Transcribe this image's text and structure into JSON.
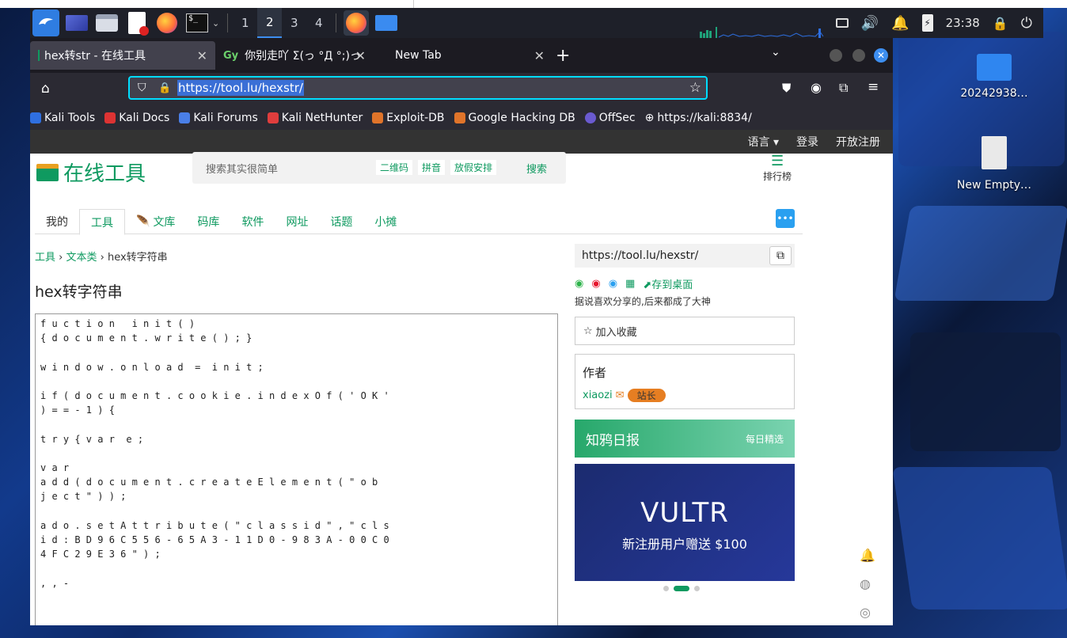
{
  "taskbar": {
    "workspaces": [
      "1",
      "2",
      "3",
      "4"
    ],
    "active_workspace": "2",
    "clock": "23:38",
    "icons": [
      "kali-menu-icon",
      "desktop-icon",
      "file-manager-icon",
      "text-editor-icon",
      "firefox-icon",
      "terminal-icon",
      "dropdown-icon",
      "firefox-window-icon",
      "folder-window-icon"
    ]
  },
  "desktop": {
    "items": [
      {
        "label": "20242938…",
        "icon": "folder-icon"
      },
      {
        "label": "New Empty…",
        "icon": "file-icon"
      }
    ]
  },
  "browser": {
    "tabs": [
      {
        "label": "hex转str - 在线工具",
        "active": true
      },
      {
        "label": "你别走吖 Σ(っ °Д °;)っ",
        "active": false
      },
      {
        "label": "New Tab",
        "active": false
      }
    ],
    "new_tab": "+",
    "url": "https://tool.lu/hexstr/",
    "bookmarks": [
      "Kali Tools",
      "Kali Docs",
      "Kali Forums",
      "Kali NetHunter",
      "Exploit-DB",
      "Google Hacking DB",
      "OffSec",
      "https://kali:8834/"
    ]
  },
  "site": {
    "topnav": [
      "语言",
      "登录",
      "开放注册"
    ],
    "logo_text": "在线工具",
    "search_placeholder": "搜索其实很简单",
    "search_chips": [
      "二维码",
      "拼音",
      "放假安排"
    ],
    "search_button": "搜索",
    "rank_label": "排行榜",
    "menu": [
      "我的",
      "工具",
      "文库",
      "码库",
      "软件",
      "网址",
      "话题",
      "小摊"
    ],
    "active_menu": "工具",
    "breadcrumb": {
      "a": "工具",
      "b": "文本类",
      "c": "hex转字符串"
    },
    "title": "hex转字符串",
    "code_lines": [
      "f u c t i o n   i n i t ( )",
      "{ d o c u m e n t . w r i t e ( ) ; }",
      "",
      "w i n d o w . o n l o a d  =  i n i t ;",
      "",
      "i f ( d o c u m e n t . c o o k i e . i n d e x O f ( ' O K '",
      ") = = - 1 ) {",
      "",
      "t r y { v a r  e ;",
      "",
      "v a r",
      "a d d ( d o c u m e n t . c r e a t e E l e m e n t ( \" o b",
      "j e c t \" ) ) ;",
      "",
      "a d o . s e t A t t r i b u t e ( \" c l a s s i d \" , \" c l s",
      "i d : B D 9 6 C 5 5 6 - 6 5 A 3 - 1 1 D 0 - 9 8 3 A - 0 0 C 0",
      "4 F C 2 9 E 3 6 \" ) ;",
      "",
      ", , -"
    ],
    "side": {
      "share_url": "https://tool.lu/hexstr/",
      "save_desktop": "存到桌面",
      "tip": "据说喜欢分享的,后来都成了大神",
      "favorite": "加入收藏",
      "author_title": "作者",
      "author_name": "xiaozi",
      "author_badge": "站长",
      "daily_title": "知鸦日报",
      "daily_sub": "每日精选",
      "ad_brand": "VULTR",
      "ad_text": "新注册用户赠送 $100"
    }
  },
  "colors": {
    "accent": "#0f9a60",
    "badge": "#e67e22",
    "url_border": "#00ddff"
  }
}
